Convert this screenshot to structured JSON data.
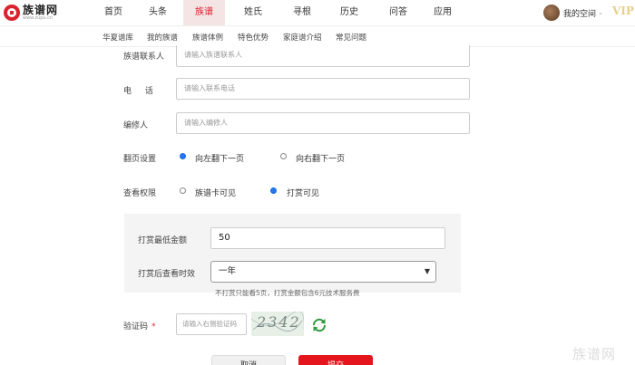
{
  "header": {
    "logo_name": "族谱网",
    "logo_url": "www.zupu.cn",
    "nav": [
      "首页",
      "头条",
      "族谱",
      "姓氏",
      "寻根",
      "历史",
      "问答",
      "应用"
    ],
    "active_nav": "族谱",
    "user_label": "我的空间",
    "vip_label": "VIP"
  },
  "subnav": [
    "华夏谱库",
    "我的族谱",
    "族谱体例",
    "特色优势",
    "家庭谱介绍",
    "常见问题"
  ],
  "form": {
    "contact_label": "族谱联系人",
    "contact_placeholder": "请输入族谱联系人",
    "phone_label": "电  话",
    "phone_placeholder": "请输入联系电话",
    "editor_label": "编修人",
    "editor_placeholder": "请输入编修人",
    "page_turn_label": "翻页设置",
    "page_turn_options": [
      "向左翻下一页",
      "向右翻下一页"
    ],
    "page_turn_selected": "向左翻下一页",
    "view_permission_label": "查看权限",
    "view_permission_options": [
      "族谱卡可见",
      "打赏可见"
    ],
    "view_permission_selected": "打赏可见",
    "min_reward_label": "打赏最低金额",
    "min_reward_value": "50",
    "validity_label": "打赏后查看时效",
    "validity_value": "一年",
    "reward_note": "不打赏只能看5页，打赏金额包含6元技术服务费",
    "captcha_label": "验证码",
    "captcha_required_mark": "*",
    "captcha_placeholder": "请输入右侧验证码",
    "captcha_image_text": "2342"
  },
  "buttons": {
    "cancel": "取消",
    "submit": "提交"
  },
  "watermark": "族谱网",
  "colors": {
    "brand_red": "#d9232d",
    "radio_blue": "#1a6fe6",
    "refresh_green": "#2e9a3c"
  }
}
